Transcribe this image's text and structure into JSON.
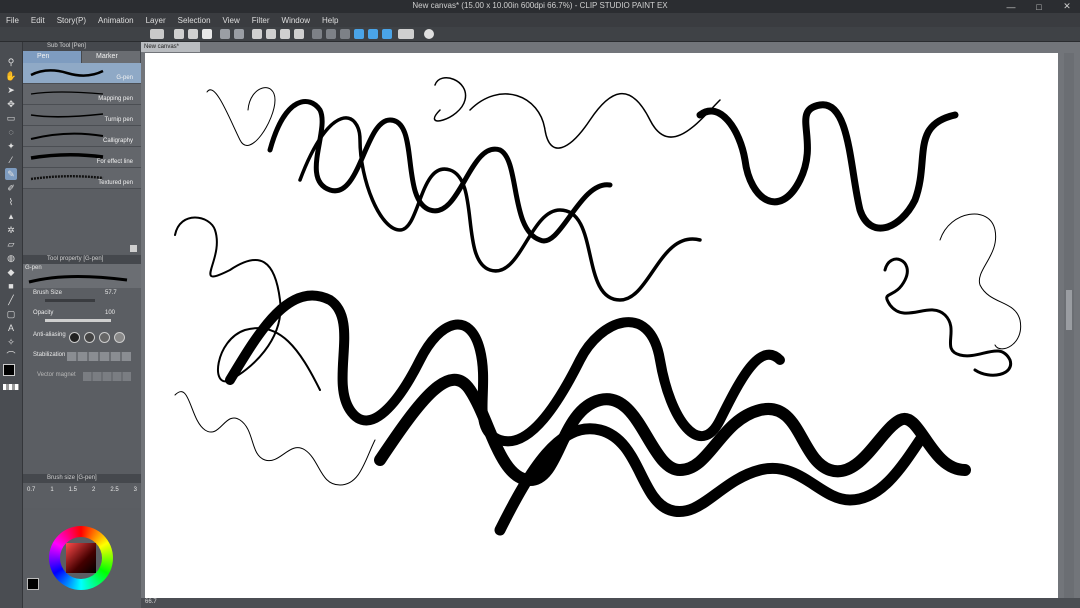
{
  "window": {
    "title": "New canvas* (15.00 x 10.00in 600dpi 66.7%) - CLIP STUDIO PAINT EX",
    "controls": [
      "—",
      "□",
      "✕"
    ]
  },
  "menu": [
    "File",
    "Edit",
    "Story(P)",
    "Animation",
    "Layer",
    "Selection",
    "View",
    "Filter",
    "Window",
    "Help"
  ],
  "subtool_panel": {
    "header": "Sub Tool [Pen]",
    "tabs": [
      "Pen",
      "Marker"
    ],
    "brushes": [
      {
        "label": "G-pen",
        "selected": true
      },
      {
        "label": "Mapping pen",
        "selected": false
      },
      {
        "label": "Turnip pen",
        "selected": false
      },
      {
        "label": "Calligraphy",
        "selected": false
      },
      {
        "label": "For effect line",
        "selected": false
      },
      {
        "label": "Textured pen",
        "selected": false
      }
    ]
  },
  "tool_property": {
    "header": "Tool property [G-pen]",
    "name": "G-pen",
    "brush_size_label": "Brush Size",
    "brush_size_value": "57.7",
    "opacity_label": "Opacity",
    "opacity_value": "100",
    "antialias_label": "Anti-aliasing",
    "stabilization_label": "Stabilization",
    "vector_magnet_label": "Vector magnet"
  },
  "brush_size_panel": {
    "header": "Brush size [G-pen]",
    "sizes": [
      "0.7",
      "1",
      "1.5",
      "2",
      "2.5",
      "3"
    ]
  },
  "document": {
    "tab_label": "New canvas*",
    "zoom": "66.7"
  },
  "colors": {
    "accent": "#7e9cc0",
    "main_color": "#000000",
    "sub_color": "#ffffff"
  }
}
